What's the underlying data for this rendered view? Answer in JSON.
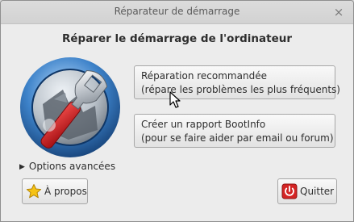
{
  "window": {
    "title": "Réparateur de démarrage",
    "close_glyph": "×"
  },
  "main": {
    "heading": "Réparer le démarrage de l'ordinateur"
  },
  "actions": {
    "recommended": {
      "line1": "Réparation recommandée",
      "line2": "(répare les problèmes les plus fréquents)"
    },
    "bootinfo": {
      "line1": "Créer un rapport BootInfo",
      "line2": "(pour se faire aider par email ou forum)"
    }
  },
  "advanced_options": {
    "label": "Options avancées",
    "expander_glyph": "▶"
  },
  "footer": {
    "about_label": "À propos",
    "about_icon": "star-icon",
    "quit_label": "Quitter",
    "quit_icon": "power-icon"
  },
  "colors": {
    "window_bg": "#ececec",
    "titlebar_bg": "#d6d6d6",
    "button_border": "#a7a7a7",
    "logo_blue": "#2f6fb3",
    "wrench_red": "#c8171b",
    "power_red": "#d42424",
    "star_yellow": "#f6c315"
  }
}
